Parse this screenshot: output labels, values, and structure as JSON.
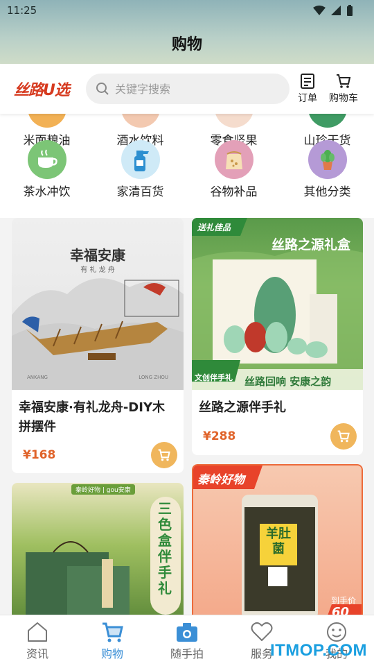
{
  "status": {
    "time": "11:25"
  },
  "header": {
    "title": "购物"
  },
  "brand": {
    "logo_text": "丝路U选"
  },
  "search": {
    "placeholder": "关键字搜索"
  },
  "header_actions": {
    "orders": "订单",
    "cart": "购物车"
  },
  "categories_row1": [
    {
      "label": "米面粮油",
      "icon": "grain-icon"
    },
    {
      "label": "酒水饮料",
      "icon": "drink-icon"
    },
    {
      "label": "零食坚果",
      "icon": "snack-icon"
    },
    {
      "label": "山珍干货",
      "icon": "mushroom-icon"
    }
  ],
  "categories_row2": [
    {
      "label": "茶水冲饮",
      "icon": "tea-cup-icon",
      "color": "#7cc576"
    },
    {
      "label": "家清百货",
      "icon": "spray-bottle-icon",
      "color": "#9ed4ef"
    },
    {
      "label": "谷物补品",
      "icon": "grain-bag-icon",
      "color": "#e3a0b8"
    },
    {
      "label": "其他分类",
      "icon": "potted-plant-icon",
      "color": "#b59ad6"
    }
  ],
  "products": [
    {
      "title": "幸福安康·有礼龙舟-DIY木拼摆件",
      "price": "¥168",
      "image_text": {
        "heading": "幸福安康",
        "sub": "有 礼 龙 舟",
        "caption_left": "ANKANG",
        "caption_right": "LONG ZHOU"
      }
    },
    {
      "title": "丝路之源伴手礼",
      "price": "¥288",
      "image_text": {
        "badge": "送礼佳品",
        "heading": "丝路之源礼盒",
        "tag": "文创伴手礼",
        "slogan": "丝路回响 安康之韵"
      }
    },
    {
      "title": "",
      "price": "",
      "image_text": {
        "banner": "秦岭好物 | gou安康",
        "vertical": "三色盒伴手礼"
      }
    },
    {
      "title": "",
      "price": "",
      "image_text": {
        "badge": "秦岭好物",
        "label": "羊肚菌",
        "promo": "到手价",
        "promo_price": "60"
      }
    }
  ],
  "tabbar": [
    {
      "label": "资讯",
      "icon": "news-icon",
      "active": false
    },
    {
      "label": "购物",
      "icon": "shopping-cart-icon",
      "active": true
    },
    {
      "label": "随手拍",
      "icon": "camera-icon",
      "active": false
    },
    {
      "label": "服务",
      "icon": "heart-icon",
      "active": false
    },
    {
      "label": "我的",
      "icon": "profile-face-icon",
      "active": false
    }
  ],
  "watermark": "ITMOP.COM",
  "colors": {
    "accent_blue": "#3b8fd6",
    "price_orange": "#e0632a",
    "cart_button": "#f0b65c",
    "logo_red": "#d63a1f"
  }
}
